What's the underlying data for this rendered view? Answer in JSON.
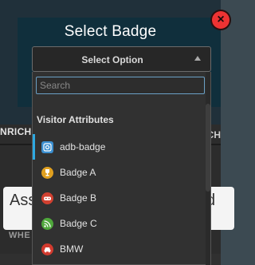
{
  "modal": {
    "title": "Select Badge",
    "close_label": "×"
  },
  "select": {
    "label": "Select Option"
  },
  "search": {
    "placeholder": "Search",
    "value": ""
  },
  "group": {
    "title": "Visitor Attributes"
  },
  "options": [
    {
      "label": "adb-badge",
      "icon": "instagram-icon",
      "color": "#3b8fd0"
    },
    {
      "label": "Badge A",
      "icon": "trophy-icon",
      "color": "#e0a020"
    },
    {
      "label": "Badge B",
      "icon": "gamepad-icon",
      "color": "#d04030"
    },
    {
      "label": "Badge C",
      "icon": "rss-icon",
      "color": "#4fa83c"
    },
    {
      "label": "BMW",
      "icon": "car-icon",
      "color": "#d23a2e"
    }
  ],
  "background": {
    "left_tab": "NRICH",
    "right_tab": "CH",
    "input_left": "Ass",
    "input_right": "d",
    "when_label": "WHE"
  },
  "colors": {
    "accent": "#2ea8e0",
    "close": "#e33333",
    "modal_bg": "#102f3c"
  }
}
